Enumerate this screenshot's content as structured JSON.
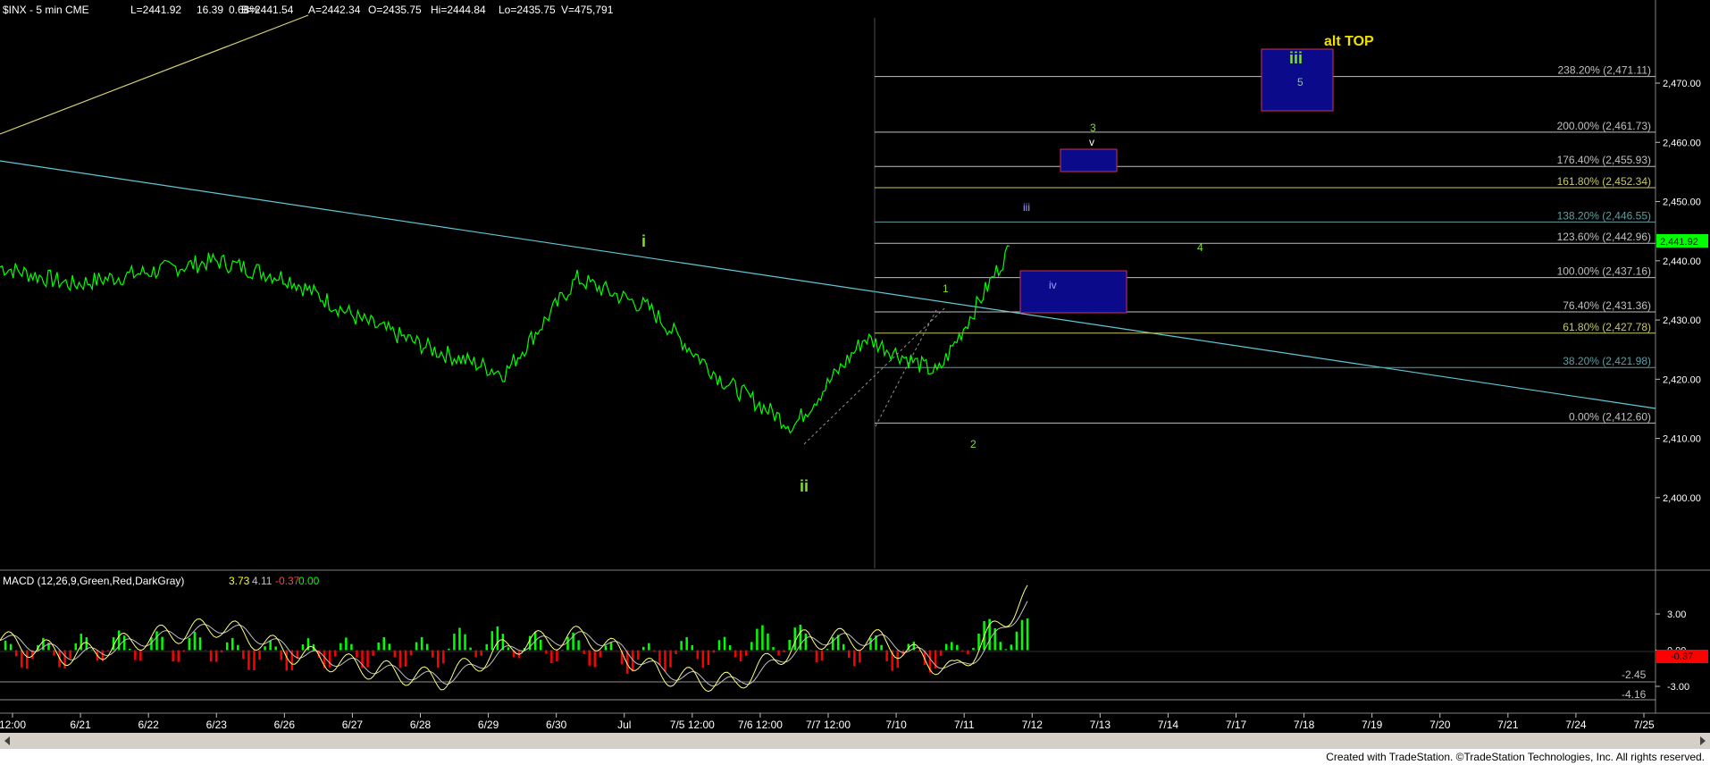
{
  "header": {
    "symbol": "$INX - 5 min  CME",
    "last": "L=2441.92",
    "change": "16.39",
    "change_pct": "0.68%",
    "bid": "B=2441.54",
    "ask": "A=2442.34",
    "open": "O=2435.75",
    "high": "Hi=2444.84",
    "low": "Lo=2435.75",
    "volume": "V=475,791"
  },
  "macd_header": {
    "label": "MACD (12,26,9,Green,Red,DarkGray)",
    "v1": "3.73",
    "v2": "4.11",
    "v3": "-0.37",
    "v4": "0.00"
  },
  "price_axis": [
    "2,470.00",
    "2,460.00",
    "2,450.00",
    "2,440.00",
    "2,430.00",
    "2,420.00",
    "2,410.00",
    "2,400.00"
  ],
  "last_price_label": "2,441.92",
  "macd_axis": [
    "3.00",
    "0.00",
    "-3.00"
  ],
  "macd_current_label": "-0.37",
  "macd_levels": [
    "-2.45",
    "-4.16"
  ],
  "time_axis": [
    "12:00",
    "6/21",
    "6/22",
    "6/23",
    "6/26",
    "6/27",
    "6/28",
    "6/29",
    "6/30",
    "Jul",
    "7/5 12:00",
    "7/6 12:00",
    "7/7 12:00",
    "7/10",
    "7/11",
    "7/12",
    "7/13",
    "7/14",
    "7/17",
    "7/18",
    "7/19",
    "7/20",
    "7/21",
    "7/24",
    "7/25"
  ],
  "fib_labels": [
    {
      "text": "238.20% (2,471.11)",
      "color": "#c0c0c0"
    },
    {
      "text": "200.00% (2,461.73)",
      "color": "#c0c0c0"
    },
    {
      "text": "176.40% (2,455.93)",
      "color": "#c0c0c0"
    },
    {
      "text": "161.80% (2,452.34)",
      "color": "#c8c86a"
    },
    {
      "text": "138.20% (2,446.55)",
      "color": "#5f9ea0"
    },
    {
      "text": "123.60% (2,442.96)",
      "color": "#c0c0c0"
    },
    {
      "text": "100.00% (2,437.16)",
      "color": "#c0c0c0"
    },
    {
      "text": "76.40% (2,431.36)",
      "color": "#c0c0c0"
    },
    {
      "text": "61.80% (2,427.78)",
      "color": "#c8c86a"
    },
    {
      "text": "38.20% (2,421.98)",
      "color": "#5f9ea0"
    },
    {
      "text": "0.00% (2,412.60)",
      "color": "#c0c0c0"
    }
  ],
  "annotations": {
    "wave_i": "i",
    "wave_ii": "ii",
    "wave_1": "1",
    "wave_2": "2",
    "wave_3": "3",
    "wave_4": "4",
    "wave_5": "5",
    "wave_iii_small": "iii",
    "wave_iv_small": "iv",
    "wave_v_small": "v",
    "wave_iii_big": "iii",
    "alt_top": "alt TOP"
  },
  "footer": "Created with TradeStation. ©TradeStation Technologies, Inc. All rights reserved.",
  "colors": {
    "price": "#00ff00",
    "macd_line": "#ffff80",
    "signal_line": "#c0c0c0",
    "hist_up": "#00ff00",
    "hist_down": "#ff0000",
    "trend_cyan": "#5fc8d8",
    "trend_yellow": "#d8d070",
    "box_fill": "#0a0a8a",
    "box_border": "#d0305a",
    "wave_green": "#7fdf2f",
    "alt_top": "#f0e000"
  },
  "chart_data": {
    "type": "line",
    "title": "$INX - 5 min  CME",
    "x": [
      "6/21",
      "6/22",
      "6/23",
      "6/26",
      "6/27",
      "6/28",
      "6/29",
      "6/30",
      "Jul",
      "7/5",
      "7/6",
      "7/7",
      "7/10",
      "7/11",
      "7/12"
    ],
    "series": [
      {
        "name": "$INX",
        "values": [
          2439,
          2436,
          2438,
          2440,
          2437,
          2430,
          2425,
          2421,
          2437,
          2432,
          2420,
          2412,
          2427,
          2421,
          2442
        ]
      },
      {
        "name": "MACD",
        "values": [
          0.8,
          -0.5,
          1.0,
          2.0,
          -0.3,
          -1.5,
          -2.5,
          0.5,
          1.2,
          -2.0,
          -2.8,
          1.0,
          0.8,
          -1.8,
          4.5
        ]
      }
    ],
    "ylim": [
      2395,
      2478
    ],
    "ylabel": "",
    "xlabel": "",
    "fib_levels": [
      {
        "pct": 238.2,
        "price": 2471.11
      },
      {
        "pct": 200.0,
        "price": 2461.73
      },
      {
        "pct": 176.4,
        "price": 2455.93
      },
      {
        "pct": 161.8,
        "price": 2452.34
      },
      {
        "pct": 138.2,
        "price": 2446.55
      },
      {
        "pct": 123.6,
        "price": 2442.96
      },
      {
        "pct": 100.0,
        "price": 2437.16
      },
      {
        "pct": 76.4,
        "price": 2431.36
      },
      {
        "pct": 61.8,
        "price": 2427.78
      },
      {
        "pct": 38.2,
        "price": 2421.98
      },
      {
        "pct": 0.0,
        "price": 2412.6
      }
    ],
    "macd_ylim": [
      -5,
      5
    ]
  }
}
